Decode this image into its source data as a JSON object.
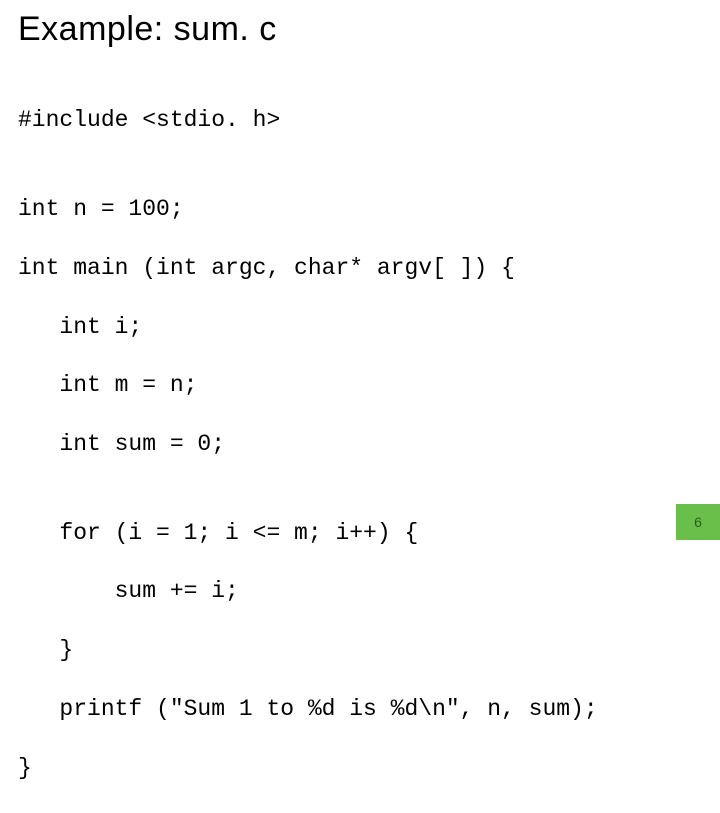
{
  "title": "Example: sum. c",
  "code": {
    "l0": "#include <stdio. h>",
    "l1": "",
    "l2": "int n = 100;",
    "l3": "int main (int argc, char* argv[ ]) {",
    "l4": "   int i;",
    "l5": "   int m = n;",
    "l6": "   int sum = 0;",
    "l7": "",
    "l8": "   for (i = 1; i <= m; i++) {",
    "l9": "       sum += i;",
    "l10": "   }",
    "l11": "   printf (\"Sum 1 to %d is %d\\n\", n, sum);",
    "l12": "}"
  },
  "page_number": "6"
}
